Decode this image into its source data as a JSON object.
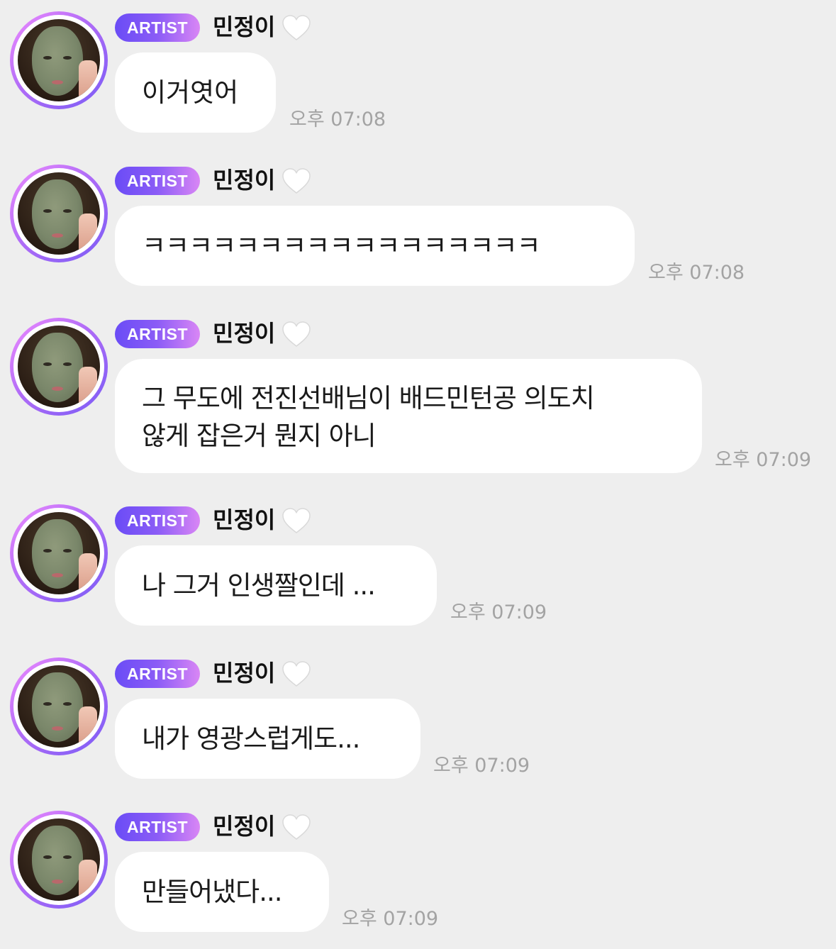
{
  "chat": {
    "messages": [
      {
        "badge": "ARTIST",
        "sender": "민정이",
        "heart_icon": "white-heart-icon",
        "text": "이거엿어",
        "time": "오후 07:08"
      },
      {
        "badge": "ARTIST",
        "sender": "민정이",
        "heart_icon": "white-heart-icon",
        "text": "ㅋㅋㅋㅋㅋㅋㅋㅋㅋㅋㅋㅋㅋㅋㅋㅋㅋ",
        "time": "오후 07:08"
      },
      {
        "badge": "ARTIST",
        "sender": "민정이",
        "heart_icon": "white-heart-icon",
        "text": "그 무도에 전진선배님이 배드민턴공 의도치\n않게 잡은거 뭔지 아니",
        "time": "오후 07:09"
      },
      {
        "badge": "ARTIST",
        "sender": "민정이",
        "heart_icon": "white-heart-icon",
        "text": "나 그거 인생짤인데 ...",
        "time": "오후 07:09"
      },
      {
        "badge": "ARTIST",
        "sender": "민정이",
        "heart_icon": "white-heart-icon",
        "text": "내가 영광스럽게도...",
        "time": "오후 07:09"
      },
      {
        "badge": "ARTIST",
        "sender": "민정이",
        "heart_icon": "white-heart-icon",
        "text": "만들어냈다...",
        "time": "오후 07:09"
      }
    ]
  },
  "colors": {
    "background": "#eeeeee",
    "bubble": "#ffffff",
    "badge_gradient_start": "#6a4cf6",
    "badge_gradient_end": "#d986f5",
    "timestamp": "#a3a3a3"
  }
}
